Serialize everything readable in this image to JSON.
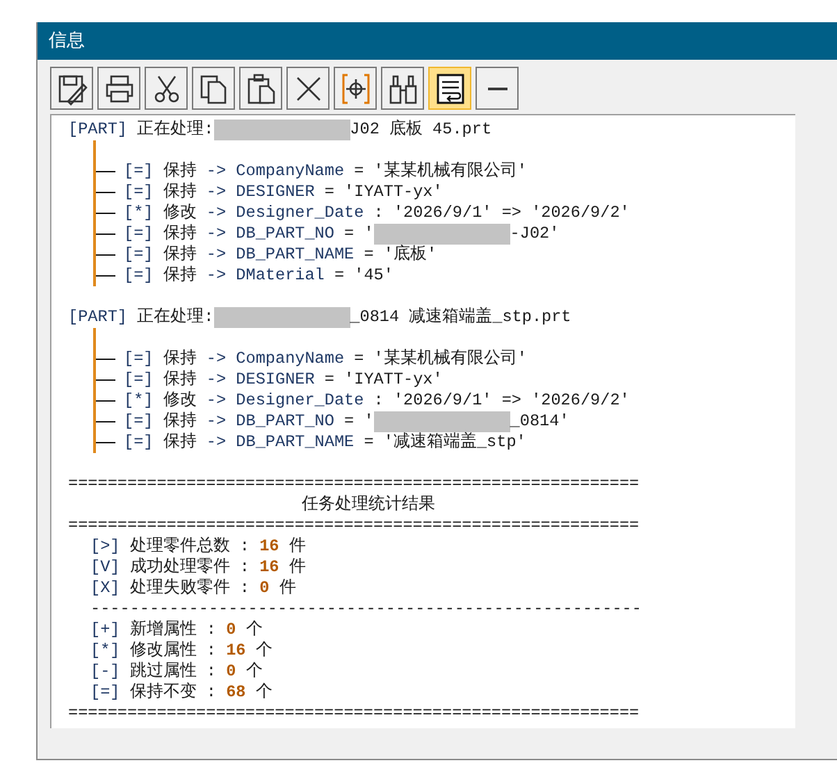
{
  "window": {
    "title": "信息"
  },
  "toolbar": [
    {
      "kind": "save",
      "selected": false
    },
    {
      "kind": "print",
      "selected": false
    },
    {
      "kind": "cut",
      "selected": false
    },
    {
      "kind": "copy",
      "selected": false
    },
    {
      "kind": "paste",
      "selected": false
    },
    {
      "kind": "delete",
      "selected": false
    },
    {
      "kind": "target",
      "selected": false
    },
    {
      "kind": "find",
      "selected": false
    },
    {
      "kind": "wrap",
      "selected": true
    },
    {
      "kind": "minimize",
      "selected": false
    }
  ],
  "parts": [
    {
      "tag": "[PART]",
      "label": "正在处理:",
      "redacted": true,
      "file": "J02 底板 45.prt",
      "attributes": [
        {
          "mark": "[=]",
          "action": "保持",
          "arrow": "->",
          "key": "CompanyName",
          "op": "=",
          "value": "'某某机械有限公司'"
        },
        {
          "mark": "[=]",
          "action": "保持",
          "arrow": "->",
          "key": "DESIGNER",
          "op": "=",
          "value": "'IYATT-yx'"
        },
        {
          "mark": "[*]",
          "action": "修改",
          "arrow": "->",
          "key": "Designer_Date",
          "op": ":",
          "value": "'2026/9/1' => '2026/9/2'"
        },
        {
          "mark": "[=]",
          "action": "保持",
          "arrow": "->",
          "key": "DB_PART_NO",
          "op": "=",
          "value": "'",
          "redacted": true,
          "value_after": "-J02'"
        },
        {
          "mark": "[=]",
          "action": "保持",
          "arrow": "->",
          "key": "DB_PART_NAME",
          "op": "=",
          "value": "'底板'"
        },
        {
          "mark": "[=]",
          "action": "保持",
          "arrow": "->",
          "key": "DMaterial",
          "op": "=",
          "value": "'45'"
        }
      ]
    },
    {
      "tag": "[PART]",
      "label": "正在处理:",
      "redacted": true,
      "file": "_0814 减速箱端盖_stp.prt",
      "attributes": [
        {
          "mark": "[=]",
          "action": "保持",
          "arrow": "->",
          "key": "CompanyName",
          "op": "=",
          "value": "'某某机械有限公司'"
        },
        {
          "mark": "[=]",
          "action": "保持",
          "arrow": "->",
          "key": "DESIGNER",
          "op": "=",
          "value": "'IYATT-yx'"
        },
        {
          "mark": "[*]",
          "action": "修改",
          "arrow": "->",
          "key": "Designer_Date",
          "op": ":",
          "value": "'2026/9/1' => '2026/9/2'"
        },
        {
          "mark": "[=]",
          "action": "保持",
          "arrow": "->",
          "key": "DB_PART_NO",
          "op": "=",
          "value": "'",
          "redacted": true,
          "value_after": "_0814'"
        },
        {
          "mark": "[=]",
          "action": "保持",
          "arrow": "->",
          "key": "DB_PART_NAME",
          "op": "=",
          "value": "'减速箱端盖_stp'"
        }
      ]
    }
  ],
  "summary": {
    "rule_top": "==========================================================",
    "title": "任务处理统计结果",
    "rule_mid": "==========================================================",
    "parts_stats": [
      {
        "mark": "[>]",
        "label": "处理零件总数",
        "sep": ":",
        "count": "16",
        "unit": "件"
      },
      {
        "mark": "[V]",
        "label": "成功处理零件",
        "sep": ":",
        "count": "16",
        "unit": "件"
      },
      {
        "mark": "[X]",
        "label": "处理失败零件",
        "sep": ":",
        "count": "0",
        "unit": "件"
      }
    ],
    "rule_dash": "--------------------------------------------------------",
    "attr_stats": [
      {
        "mark": "[+]",
        "label": "新增属性",
        "sep": ":",
        "count": "0",
        "unit": "个"
      },
      {
        "mark": "[*]",
        "label": "修改属性",
        "sep": ":",
        "count": "16",
        "unit": "个"
      },
      {
        "mark": "[-]",
        "label": "跳过属性",
        "sep": ":",
        "count": "0",
        "unit": "个"
      },
      {
        "mark": "[=]",
        "label": "保持不变",
        "sep": ":",
        "count": "68",
        "unit": "个"
      }
    ],
    "rule_bottom": "=========================================================="
  }
}
